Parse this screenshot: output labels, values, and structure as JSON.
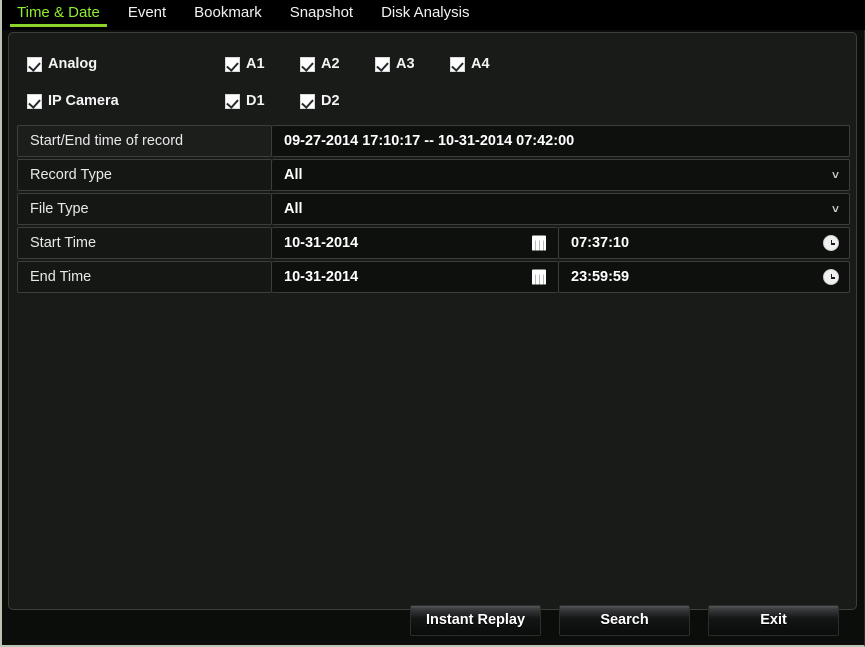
{
  "tabs": [
    {
      "label": "Time & Date",
      "active": true
    },
    {
      "label": "Event",
      "active": false
    },
    {
      "label": "Bookmark",
      "active": false
    },
    {
      "label": "Snapshot",
      "active": false
    },
    {
      "label": "Disk Analysis",
      "active": false
    }
  ],
  "channels": {
    "analog": {
      "group_label": "Analog",
      "group_checked": true,
      "items": [
        {
          "label": "A1",
          "checked": true
        },
        {
          "label": "A2",
          "checked": true
        },
        {
          "label": "A3",
          "checked": true
        },
        {
          "label": "A4",
          "checked": true
        }
      ]
    },
    "ip_camera": {
      "group_label": "IP Camera",
      "group_checked": true,
      "items": [
        {
          "label": "D1",
          "checked": true
        },
        {
          "label": "D2",
          "checked": true
        }
      ]
    }
  },
  "fields": {
    "record_span": {
      "label": "Start/End time of record",
      "value": "09-27-2014 17:10:17 -- 10-31-2014 07:42:00"
    },
    "record_type": {
      "label": "Record Type",
      "value": "All",
      "chevron": "chevron-down-icon"
    },
    "file_type": {
      "label": "File Type",
      "value": "All",
      "chevron": "chevron-down-icon"
    },
    "start_time": {
      "label": "Start Time",
      "date": "10-31-2014",
      "time": "07:37:10"
    },
    "end_time": {
      "label": "End Time",
      "date": "10-31-2014",
      "time": "23:59:59"
    }
  },
  "buttons": {
    "instant_replay": "Instant Replay",
    "search": "Search",
    "exit": "Exit"
  },
  "colors": {
    "active_tab": "#90ee2e",
    "panel_bg": "#191b19",
    "calendar_icon_accent": "#d11f1f"
  },
  "glyphs": {
    "chevron_down": "˅"
  }
}
